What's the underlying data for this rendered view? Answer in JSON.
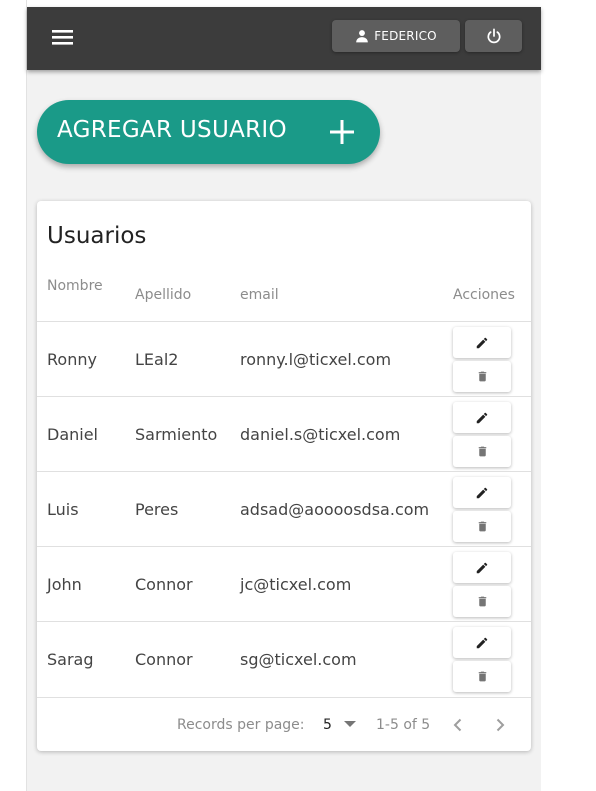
{
  "header": {
    "user_label": "FEDERICO"
  },
  "fab": {
    "label": "AGREGAR USUARIO"
  },
  "table": {
    "title": "Usuarios",
    "columns": [
      "Nombre",
      "Apellido",
      "email",
      "Acciones"
    ],
    "rows": [
      {
        "nombre": "Ronny",
        "apellido": "LEal2",
        "email": "ronny.l@ticxel.com"
      },
      {
        "nombre": "Daniel",
        "apellido": "Sarmiento",
        "email": "daniel.s@ticxel.com"
      },
      {
        "nombre": "Luis",
        "apellido": "Peres",
        "email": "adsad@aoooosdsa.com"
      },
      {
        "nombre": "John",
        "apellido": "Connor",
        "email": "jc@ticxel.com"
      },
      {
        "nombre": "Sarag",
        "apellido": "Connor",
        "email": "sg@ticxel.com"
      }
    ]
  },
  "pagination": {
    "records_label": "Records per page:",
    "per_page": "5",
    "range": "1-5 of 5"
  },
  "icons": {
    "menu": "menu-icon",
    "user": "person-icon",
    "power": "power-icon",
    "add": "plus-icon",
    "edit": "pencil-icon",
    "delete": "trash-icon",
    "dropdown": "caret-down-icon",
    "prev": "chevron-left-icon",
    "next": "chevron-right-icon"
  },
  "colors": {
    "appbar": "#3c3c3c",
    "button_dark": "#5e5e5e",
    "accent": "#1a9a88",
    "background": "#f2f2f2"
  }
}
